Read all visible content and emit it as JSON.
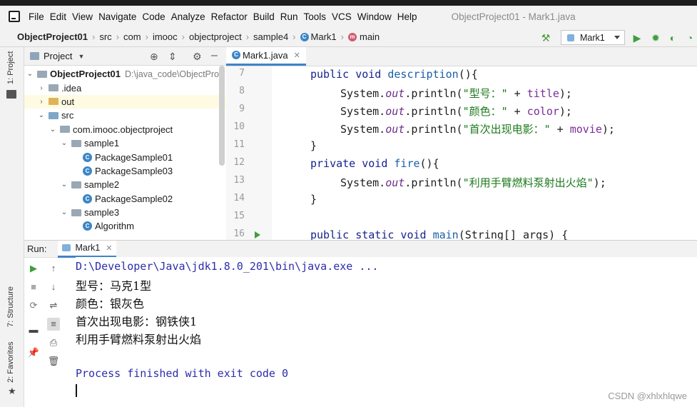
{
  "menu": [
    "File",
    "Edit",
    "View",
    "Navigate",
    "Code",
    "Analyze",
    "Refactor",
    "Build",
    "Run",
    "Tools",
    "VCS",
    "Window",
    "Help"
  ],
  "window_title": "ObjectProject01 - Mark1.java",
  "breadcrumb": [
    "ObjectProject01",
    "src",
    "com",
    "imooc",
    "objectproject",
    "sample4",
    "Mark1",
    "main"
  ],
  "run_config": "Mark1",
  "left_tabs": {
    "project": "1: Project",
    "structure": "7: Structure",
    "favorites": "2: Favorites"
  },
  "project_panel": {
    "header": "Project",
    "root": {
      "label": "ObjectProject01",
      "path": "D:\\java_code\\ObjectPro"
    },
    "items": [
      {
        "label": ".idea"
      },
      {
        "label": "out"
      },
      {
        "label": "src"
      },
      {
        "label": "com.imooc.objectproject"
      },
      {
        "label": "sample1"
      },
      {
        "label": "PackageSample01"
      },
      {
        "label": "PackageSample03"
      },
      {
        "label": "sample2"
      },
      {
        "label": "PackageSample02"
      },
      {
        "label": "sample3"
      },
      {
        "label": "Algorithm"
      }
    ]
  },
  "editor": {
    "tab": "Mark1.java",
    "line_numbers": [
      "7",
      "8",
      "9",
      "10",
      "11",
      "12",
      "13",
      "14",
      "15",
      "16"
    ],
    "code": {
      "l7": {
        "kw": "public void ",
        "name": "description",
        "rest": "(){"
      },
      "l8": {
        "pre": "System.",
        "fld": "out",
        "call": ".println(",
        "str": "\"型号：\"",
        "plus": " + ",
        "var": "title",
        "end": ");"
      },
      "l9": {
        "pre": "System.",
        "fld": "out",
        "call": ".println(",
        "str": "\"颜色：\"",
        "plus": " + ",
        "var": "color",
        "end": ");"
      },
      "l10": {
        "pre": "System.",
        "fld": "out",
        "call": ".println(",
        "str": "\"首次出现电影：\"",
        "plus": " + ",
        "var": "movie",
        "end": ");"
      },
      "l11": "}",
      "l12": {
        "kw": "private void ",
        "name": "fire",
        "rest": "(){"
      },
      "l13": {
        "pre": "System.",
        "fld": "out",
        "call": ".println(",
        "str": "\"利用手臂燃料泵射出火焰\"",
        "end": ");"
      },
      "l14": "}",
      "l16": {
        "kw": "public static void ",
        "name": "main",
        "rest": "(String[] args) {"
      }
    }
  },
  "run_panel": {
    "label": "Run:",
    "tab": "Mark1",
    "console": [
      "D:\\Developer\\Java\\jdk1.8.0_201\\bin\\java.exe ...",
      "型号：马克1型",
      "颜色：银灰色",
      "首次出现电影：钢铁侠1",
      "利用手臂燃料泵射出火焰",
      "Process finished with exit code 0"
    ]
  },
  "watermark": "CSDN @xhlxhlqwe",
  "colors": {
    "accent": "#4083c9",
    "keyword": "#17238f",
    "string": "#1d7a1d",
    "run_green": "#3e9e3e"
  }
}
